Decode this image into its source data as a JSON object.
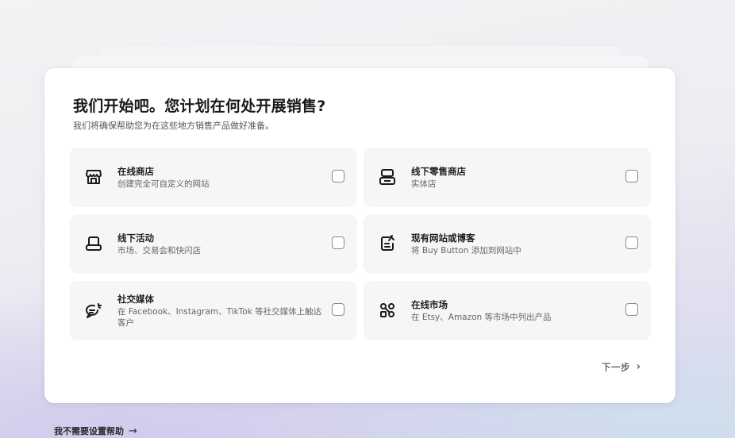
{
  "onboarding": {
    "title": "我们开始吧。您计划在何处开展销售?",
    "subtitle": "我们将确保帮助您为在这些地方销售产品做好准备。",
    "options": [
      {
        "title": "在线商店",
        "desc": "创建完全可自定义的网站",
        "icon": "storefront-icon"
      },
      {
        "title": "线下零售商店",
        "desc": "实体店",
        "icon": "pos-register-icon"
      },
      {
        "title": "线下活动",
        "desc": "市场、交易会和快闪店",
        "icon": "popup-booth-icon"
      },
      {
        "title": "现有网站或博客",
        "desc": "将 Buy Button 添加到网站中",
        "icon": "edit-document-icon"
      },
      {
        "title": "社交媒体",
        "desc": "在 Facebook、Instagram、TikTok 等社交媒体上触达客户",
        "icon": "chat-bubble-icon"
      },
      {
        "title": "在线市场",
        "desc": "在 Etsy、Amazon 等市场中列出产品",
        "icon": "marketplace-network-icon"
      }
    ],
    "next_label": "下一步",
    "next_icon": "›",
    "skip_label": "我不需要设置帮助",
    "skip_icon": "→"
  }
}
